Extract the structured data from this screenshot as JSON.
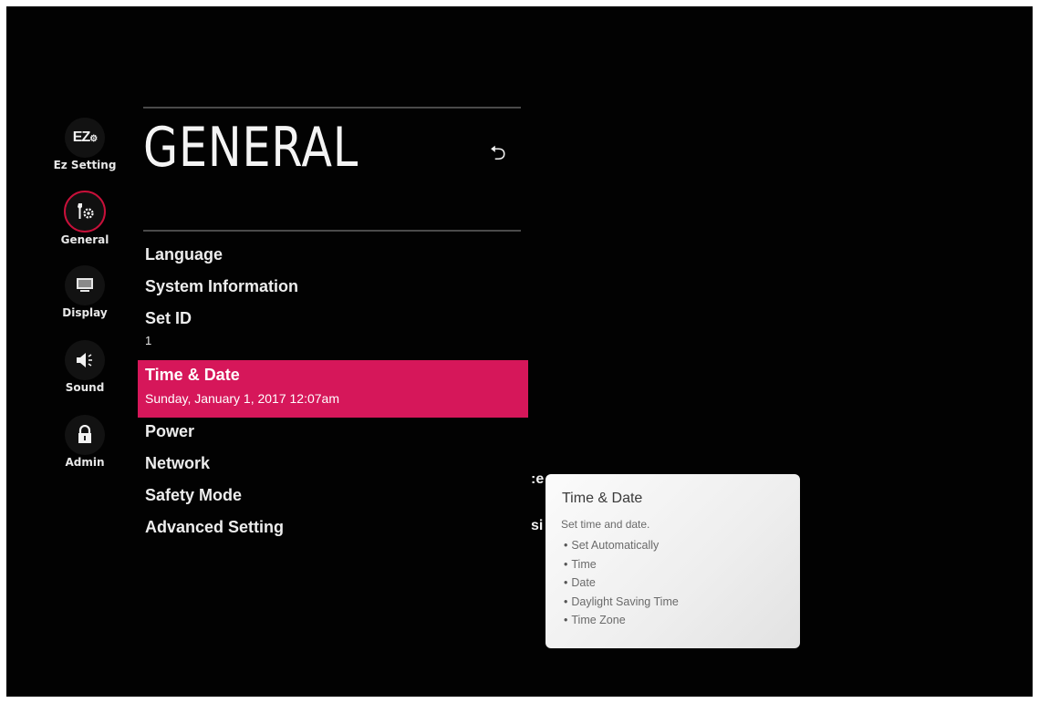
{
  "sidebar": {
    "items": [
      {
        "label": "Ez Setting",
        "icon": "ez-setting-icon",
        "active": false
      },
      {
        "label": "General",
        "icon": "wrench-gear-icon",
        "active": true
      },
      {
        "label": "Display",
        "icon": "display-icon",
        "active": false
      },
      {
        "label": "Sound",
        "icon": "speaker-icon",
        "active": false
      },
      {
        "label": "Admin",
        "icon": "lock-icon",
        "active": false
      }
    ],
    "ez_icon_text": "EZ"
  },
  "main": {
    "title": "GENERAL",
    "back_icon": "back-arrow-icon",
    "menu": [
      {
        "label": "Language"
      },
      {
        "label": "System Information"
      },
      {
        "label": "Set ID",
        "value": "1"
      },
      {
        "label": "Time & Date",
        "value": "Sunday, January 1, 2017 12:07am",
        "selected": true
      },
      {
        "label": "Power"
      },
      {
        "label": "Network"
      },
      {
        "label": "Safety Mode"
      },
      {
        "label": "Advanced Setting"
      }
    ],
    "peek_text_1": ":e",
    "peek_text_2": "si"
  },
  "popup": {
    "title": "Time & Date",
    "description": "Set time and date.",
    "items": [
      "Set Automatically",
      "Time",
      "Date",
      "Daylight Saving Time",
      "Time Zone"
    ]
  },
  "colors": {
    "accent": "#d6175a",
    "active_ring": "#c8103a",
    "background": "#020202"
  }
}
